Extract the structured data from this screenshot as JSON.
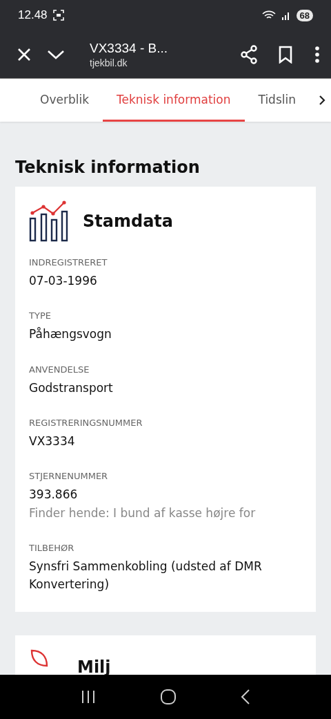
{
  "status_bar": {
    "time": "12.48",
    "battery": "68"
  },
  "toolbar": {
    "title": "VX3334 - B...",
    "url": "tjekbil.dk"
  },
  "tabs": [
    {
      "label": "Overblik",
      "selected": false
    },
    {
      "label": "Teknisk information",
      "selected": true
    },
    {
      "label": "Tidslin",
      "selected": false
    }
  ],
  "page_title": "Teknisk information",
  "card": {
    "title": "Stamdata",
    "fields": [
      {
        "label": "INDREGISTRERET",
        "value": "07-03-1996"
      },
      {
        "label": "TYPE",
        "value": "Påhængsvogn"
      },
      {
        "label": "ANVENDELSE",
        "value": "Godstransport"
      },
      {
        "label": "REGISTRERINGSNUMMER",
        "value": "VX3334"
      },
      {
        "label": "STJERNENUMMER",
        "value": "393.866",
        "note": "Finder hende: I bund af kasse højre for"
      },
      {
        "label": "TILBEHØR",
        "value": "Synsfri Sammenkobling (udsted af DMR Konvertering)"
      }
    ]
  },
  "next_card": {
    "title": "Milj"
  }
}
